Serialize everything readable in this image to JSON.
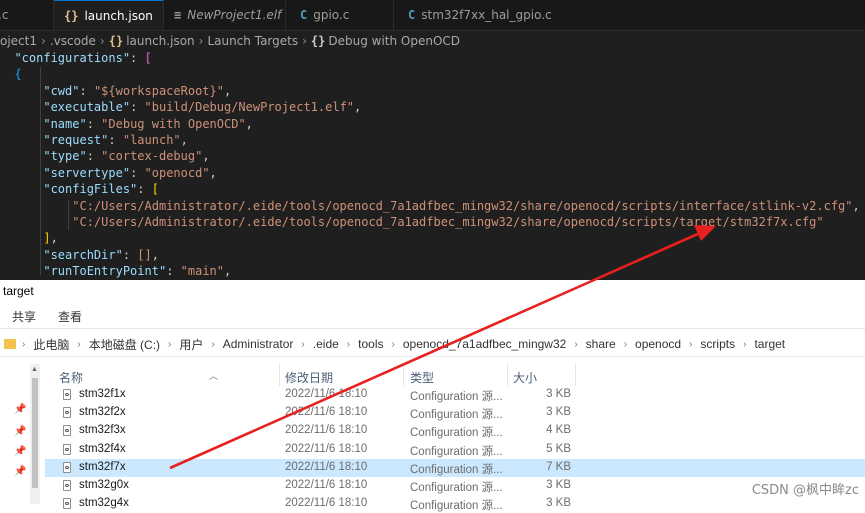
{
  "editor": {
    "tabs": [
      {
        "icon": "",
        "label": ".c"
      },
      {
        "icon": "{}",
        "label": "launch.json",
        "close": "×"
      },
      {
        "icon": "≡",
        "label": "NewProject1.elf"
      },
      {
        "icon": "C",
        "label": "gpio.c"
      },
      {
        "icon": "C",
        "label": "stm32f7xx_hal_gpio.c"
      }
    ],
    "breadcrumb": [
      "oject1",
      ".vscode",
      "launch.json",
      "Launch Targets",
      "Debug with OpenOCD"
    ],
    "code_lines": [
      {
        "indent": "  ",
        "key": "\"configurations\"",
        "after": ": ",
        "value": "",
        "bracket": "["
      },
      {
        "indent": "  ",
        "key": "",
        "after": "",
        "value": "",
        "bracket": "{"
      },
      {
        "indent": "      ",
        "key": "\"cwd\"",
        "after": ": ",
        "value": "\"${workspaceRoot}\"",
        "tail": ","
      },
      {
        "indent": "      ",
        "key": "\"executable\"",
        "after": ": ",
        "value": "\"build/Debug/NewProject1.elf\"",
        "tail": ","
      },
      {
        "indent": "      ",
        "key": "\"name\"",
        "after": ": ",
        "value": "\"Debug with OpenOCD\"",
        "tail": ","
      },
      {
        "indent": "      ",
        "key": "\"request\"",
        "after": ": ",
        "value": "\"launch\"",
        "tail": ","
      },
      {
        "indent": "      ",
        "key": "\"type\"",
        "after": ": ",
        "value": "\"cortex-debug\"",
        "tail": ","
      },
      {
        "indent": "      ",
        "key": "\"servertype\"",
        "after": ": ",
        "value": "\"openocd\"",
        "tail": ","
      },
      {
        "indent": "      ",
        "key": "\"configFiles\"",
        "after": ": ",
        "value": "",
        "bracket": "["
      },
      {
        "indent": "          ",
        "key": "",
        "after": "",
        "value": "\"C:/Users/Administrator/.eide/tools/openocd_7a1adfbec_mingw32/share/openocd/scripts/interface/stlink-v2.cfg\"",
        "tail": ","
      },
      {
        "indent": "          ",
        "key": "",
        "after": "",
        "value": "\"C:/Users/Administrator/.eide/tools/openocd_7a1adfbec_mingw32/share/openocd/scripts/target/stm32f7x.cfg\"",
        "tail": ""
      },
      {
        "indent": "      ",
        "key": "",
        "after": "",
        "value": "",
        "bracket": "]",
        "tail": ","
      },
      {
        "indent": "      ",
        "key": "\"searchDir\"",
        "after": ": ",
        "value": "[]",
        "tail": ","
      },
      {
        "indent": "      ",
        "key": "\"runToEntryPoint\"",
        "after": ": ",
        "value": "\"main\"",
        "tail": ","
      }
    ]
  },
  "explorer": {
    "title": "target",
    "ribbon": [
      "共享",
      "查看"
    ],
    "address": [
      "此电脑",
      "本地磁盘 (C:)",
      "用户",
      "Administrator",
      ".eide",
      "tools",
      "openocd_7a1adfbec_mingw32",
      "share",
      "openocd",
      "scripts",
      "target"
    ],
    "columns": {
      "name": "名称",
      "date": "修改日期",
      "type": "类型",
      "size": "大小"
    },
    "files": [
      {
        "name": "stm32f1x",
        "date": "2022/11/6 18:10",
        "type": "Configuration 源...",
        "size": "3 KB"
      },
      {
        "name": "stm32f2x",
        "date": "2022/11/6 18:10",
        "type": "Configuration 源...",
        "size": "3 KB"
      },
      {
        "name": "stm32f3x",
        "date": "2022/11/6 18:10",
        "type": "Configuration 源...",
        "size": "4 KB"
      },
      {
        "name": "stm32f4x",
        "date": "2022/11/6 18:10",
        "type": "Configuration 源...",
        "size": "5 KB"
      },
      {
        "name": "stm32f7x",
        "date": "2022/11/6 18:10",
        "type": "Configuration 源...",
        "size": "7 KB",
        "selected": true
      },
      {
        "name": "stm32g0x",
        "date": "2022/11/6 18:10",
        "type": "Configuration 源...",
        "size": "3 KB"
      },
      {
        "name": "stm32g4x",
        "date": "2022/11/6 18:10",
        "type": "Configuration 源...",
        "size": "3 KB"
      }
    ]
  },
  "watermark": "CSDN @枫中眸zc",
  "colors": {
    "arrow": "#e8201f",
    "selected_row": "#cce8ff",
    "editor_bg": "#1f1f1f"
  }
}
